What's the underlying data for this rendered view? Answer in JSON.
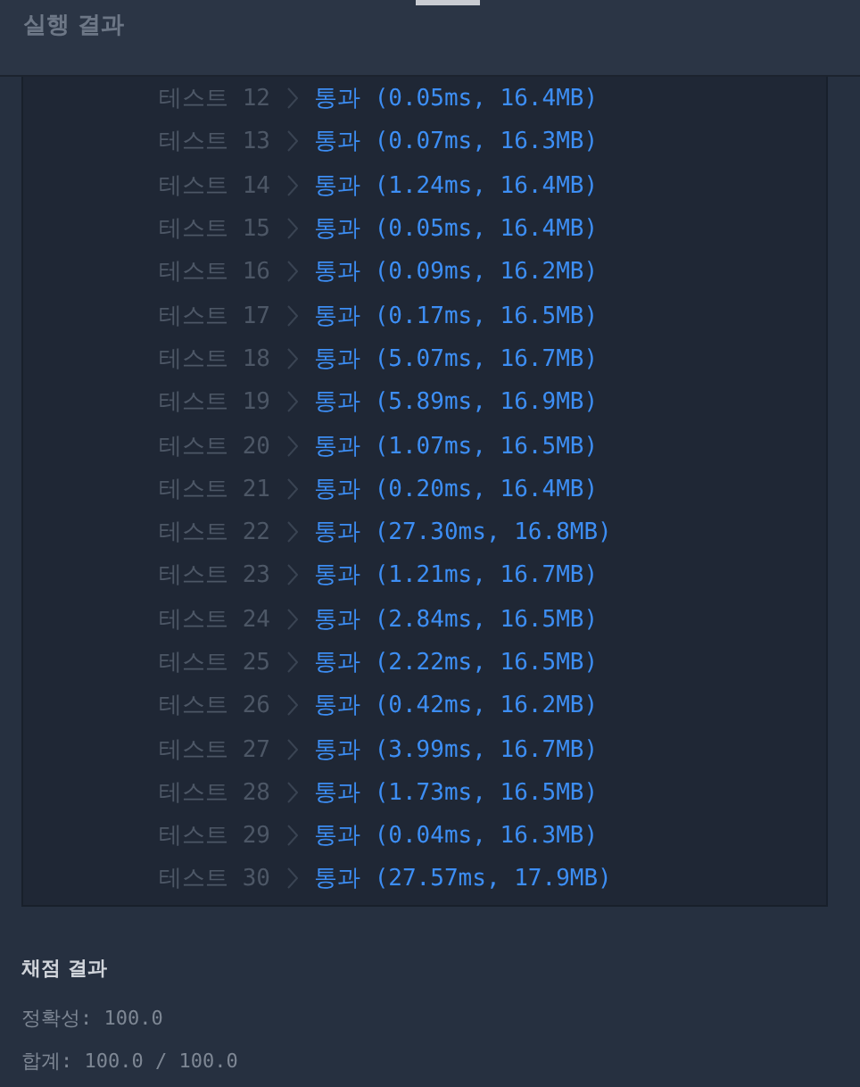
{
  "header": {
    "title": "실행 결과"
  },
  "results": [
    {
      "label": "테스트 12",
      "result": "통과 (0.05ms, 16.4MB)"
    },
    {
      "label": "테스트 13",
      "result": "통과 (0.07ms, 16.3MB)"
    },
    {
      "label": "테스트 14",
      "result": "통과 (1.24ms, 16.4MB)"
    },
    {
      "label": "테스트 15",
      "result": "통과 (0.05ms, 16.4MB)"
    },
    {
      "label": "테스트 16",
      "result": "통과 (0.09ms, 16.2MB)"
    },
    {
      "label": "테스트 17",
      "result": "통과 (0.17ms, 16.5MB)"
    },
    {
      "label": "테스트 18",
      "result": "통과 (5.07ms, 16.7MB)"
    },
    {
      "label": "테스트 19",
      "result": "통과 (5.89ms, 16.9MB)"
    },
    {
      "label": "테스트 20",
      "result": "통과 (1.07ms, 16.5MB)"
    },
    {
      "label": "테스트 21",
      "result": "통과 (0.20ms, 16.4MB)"
    },
    {
      "label": "테스트 22",
      "result": "통과 (27.30ms, 16.8MB)"
    },
    {
      "label": "테스트 23",
      "result": "통과 (1.21ms, 16.7MB)"
    },
    {
      "label": "테스트 24",
      "result": "통과 (2.84ms, 16.5MB)"
    },
    {
      "label": "테스트 25",
      "result": "통과 (2.22ms, 16.5MB)"
    },
    {
      "label": "테스트 26",
      "result": "통과 (0.42ms, 16.2MB)"
    },
    {
      "label": "테스트 27",
      "result": "통과 (3.99ms, 16.7MB)"
    },
    {
      "label": "테스트 28",
      "result": "통과 (1.73ms, 16.5MB)"
    },
    {
      "label": "테스트 29",
      "result": "통과 (0.04ms, 16.3MB)"
    },
    {
      "label": "테스트 30",
      "result": "통과 (27.57ms, 17.9MB)"
    }
  ],
  "grading": {
    "title": "채점 결과",
    "lines": [
      "정확성: 100.0",
      "합계: 100.0 / 100.0"
    ]
  }
}
